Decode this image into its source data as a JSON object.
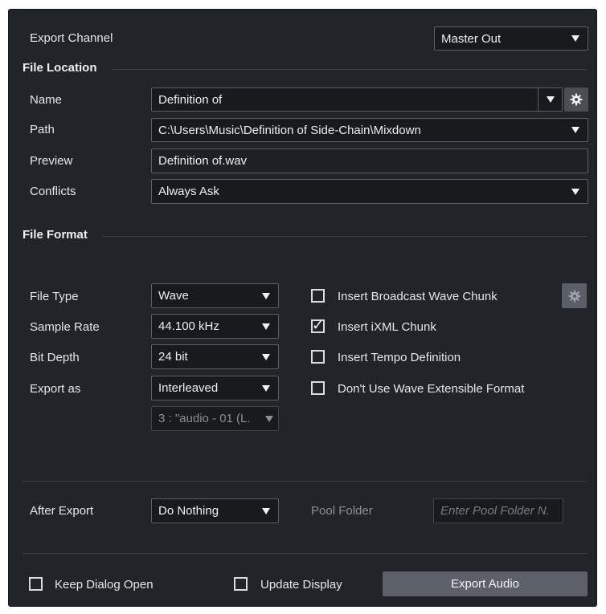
{
  "export_channel": {
    "label": "Export Channel",
    "value": "Master Out"
  },
  "file_location": {
    "heading": "File Location",
    "name": {
      "label": "Name",
      "value": "Definition of"
    },
    "path": {
      "label": "Path",
      "value": "C:\\Users\\Music\\Definition of Side-Chain\\Mixdown"
    },
    "preview": {
      "label": "Preview",
      "value": "Definition of.wav"
    },
    "conflicts": {
      "label": "Conflicts",
      "value": "Always Ask"
    }
  },
  "file_format": {
    "heading": "File Format",
    "file_type": {
      "label": "File Type",
      "value": "Wave"
    },
    "sample_rate": {
      "label": "Sample Rate",
      "value": "44.100 kHz"
    },
    "bit_depth": {
      "label": "Bit Depth",
      "value": "24 bit"
    },
    "export_as": {
      "label": "Export as",
      "value": "Interleaved"
    },
    "channel_select": {
      "value": "3 : \"audio - 01 (L."
    },
    "options": [
      {
        "label": "Insert Broadcast Wave Chunk",
        "checked": false
      },
      {
        "label": "Insert iXML Chunk",
        "checked": true
      },
      {
        "label": "Insert Tempo Definition",
        "checked": false
      },
      {
        "label": "Don't Use Wave Extensible Format",
        "checked": false
      }
    ]
  },
  "after_export": {
    "label": "After Export",
    "value": "Do Nothing",
    "pool_folder_label": "Pool Folder",
    "pool_folder_placeholder": "Enter Pool Folder N."
  },
  "footer": {
    "keep_dialog_open": {
      "label": "Keep Dialog Open",
      "checked": false
    },
    "update_display": {
      "label": "Update Display",
      "checked": false
    },
    "export_button": "Export Audio"
  },
  "icons": {
    "settings": "gear-icon",
    "dropdown": "dropdown-arrow-icon",
    "check": "check-icon"
  }
}
